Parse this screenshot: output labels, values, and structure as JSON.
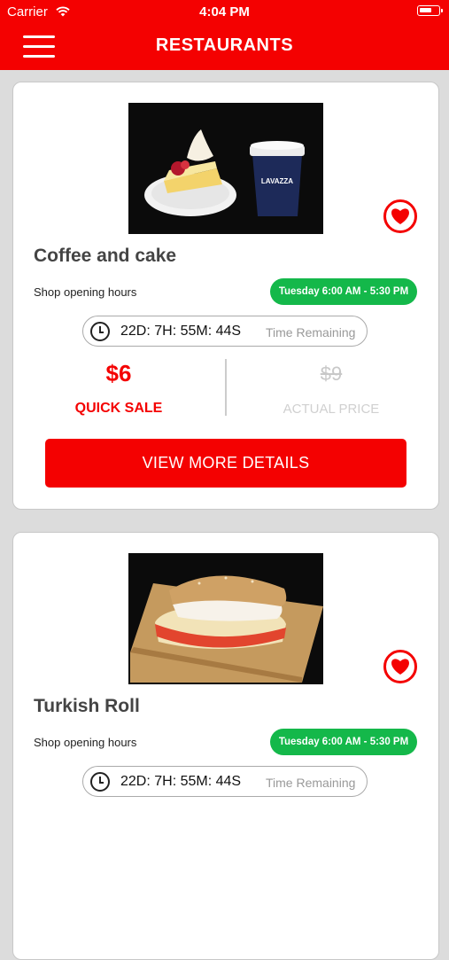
{
  "status_bar": {
    "carrier": "Carrier",
    "time": "4:04 PM"
  },
  "header": {
    "title": "RESTAURANTS"
  },
  "cards": [
    {
      "title": "Coffee and cake",
      "hours_label": "Shop opening hours",
      "hours": "Tuesday 6:00 AM - 5:30 PM",
      "countdown": "22D:  7H: 55M: 44S",
      "remaining_label": "Time Remaining",
      "sale_price": "$6",
      "sale_label": "QUICK SALE",
      "actual_price": "$9",
      "actual_label": "ACTUAL PRICE",
      "button_label": "VIEW MORE DETAILS",
      "cup_brand": "LAVAZZA"
    },
    {
      "title": "Turkish Roll",
      "hours_label": "Shop opening hours",
      "hours": "Tuesday 6:00 AM - 5:30 PM",
      "countdown": "22D:  7H: 55M: 44S",
      "remaining_label": "Time Remaining"
    }
  ],
  "colors": {
    "accent": "#f40101",
    "open_badge": "#14b84a",
    "background": "#dcdcdc"
  },
  "icons": [
    "menu-icon",
    "wifi-icon",
    "battery-icon",
    "heart-icon",
    "clock-icon"
  ]
}
